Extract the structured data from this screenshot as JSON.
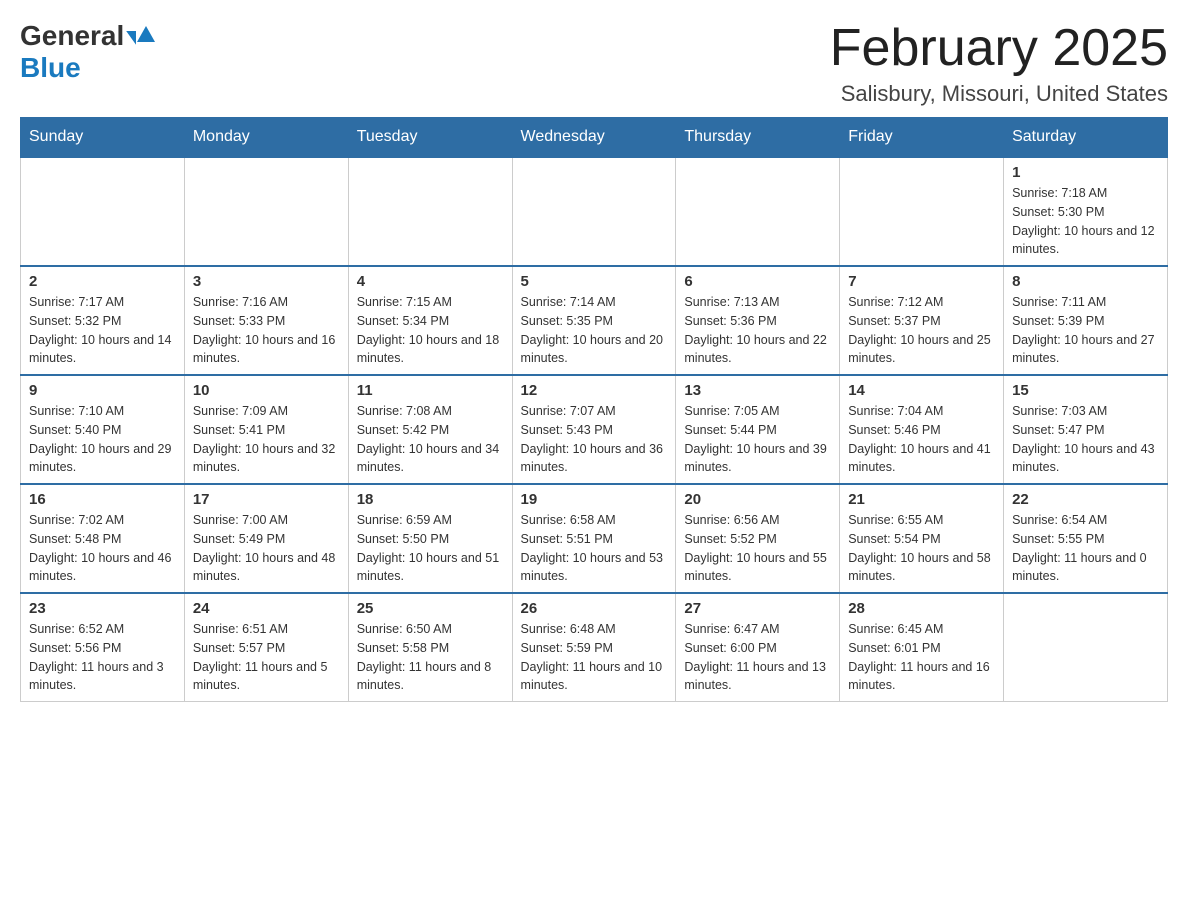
{
  "logo": {
    "general": "General",
    "blue": "Blue",
    "arrow_symbol": "▲"
  },
  "header": {
    "month_year": "February 2025",
    "location": "Salisbury, Missouri, United States"
  },
  "weekdays": [
    "Sunday",
    "Monday",
    "Tuesday",
    "Wednesday",
    "Thursday",
    "Friday",
    "Saturday"
  ],
  "weeks": [
    [
      {
        "day": "",
        "sunrise": "",
        "sunset": "",
        "daylight": ""
      },
      {
        "day": "",
        "sunrise": "",
        "sunset": "",
        "daylight": ""
      },
      {
        "day": "",
        "sunrise": "",
        "sunset": "",
        "daylight": ""
      },
      {
        "day": "",
        "sunrise": "",
        "sunset": "",
        "daylight": ""
      },
      {
        "day": "",
        "sunrise": "",
        "sunset": "",
        "daylight": ""
      },
      {
        "day": "",
        "sunrise": "",
        "sunset": "",
        "daylight": ""
      },
      {
        "day": "1",
        "sunrise": "Sunrise: 7:18 AM",
        "sunset": "Sunset: 5:30 PM",
        "daylight": "Daylight: 10 hours and 12 minutes."
      }
    ],
    [
      {
        "day": "2",
        "sunrise": "Sunrise: 7:17 AM",
        "sunset": "Sunset: 5:32 PM",
        "daylight": "Daylight: 10 hours and 14 minutes."
      },
      {
        "day": "3",
        "sunrise": "Sunrise: 7:16 AM",
        "sunset": "Sunset: 5:33 PM",
        "daylight": "Daylight: 10 hours and 16 minutes."
      },
      {
        "day": "4",
        "sunrise": "Sunrise: 7:15 AM",
        "sunset": "Sunset: 5:34 PM",
        "daylight": "Daylight: 10 hours and 18 minutes."
      },
      {
        "day": "5",
        "sunrise": "Sunrise: 7:14 AM",
        "sunset": "Sunset: 5:35 PM",
        "daylight": "Daylight: 10 hours and 20 minutes."
      },
      {
        "day": "6",
        "sunrise": "Sunrise: 7:13 AM",
        "sunset": "Sunset: 5:36 PM",
        "daylight": "Daylight: 10 hours and 22 minutes."
      },
      {
        "day": "7",
        "sunrise": "Sunrise: 7:12 AM",
        "sunset": "Sunset: 5:37 PM",
        "daylight": "Daylight: 10 hours and 25 minutes."
      },
      {
        "day": "8",
        "sunrise": "Sunrise: 7:11 AM",
        "sunset": "Sunset: 5:39 PM",
        "daylight": "Daylight: 10 hours and 27 minutes."
      }
    ],
    [
      {
        "day": "9",
        "sunrise": "Sunrise: 7:10 AM",
        "sunset": "Sunset: 5:40 PM",
        "daylight": "Daylight: 10 hours and 29 minutes."
      },
      {
        "day": "10",
        "sunrise": "Sunrise: 7:09 AM",
        "sunset": "Sunset: 5:41 PM",
        "daylight": "Daylight: 10 hours and 32 minutes."
      },
      {
        "day": "11",
        "sunrise": "Sunrise: 7:08 AM",
        "sunset": "Sunset: 5:42 PM",
        "daylight": "Daylight: 10 hours and 34 minutes."
      },
      {
        "day": "12",
        "sunrise": "Sunrise: 7:07 AM",
        "sunset": "Sunset: 5:43 PM",
        "daylight": "Daylight: 10 hours and 36 minutes."
      },
      {
        "day": "13",
        "sunrise": "Sunrise: 7:05 AM",
        "sunset": "Sunset: 5:44 PM",
        "daylight": "Daylight: 10 hours and 39 minutes."
      },
      {
        "day": "14",
        "sunrise": "Sunrise: 7:04 AM",
        "sunset": "Sunset: 5:46 PM",
        "daylight": "Daylight: 10 hours and 41 minutes."
      },
      {
        "day": "15",
        "sunrise": "Sunrise: 7:03 AM",
        "sunset": "Sunset: 5:47 PM",
        "daylight": "Daylight: 10 hours and 43 minutes."
      }
    ],
    [
      {
        "day": "16",
        "sunrise": "Sunrise: 7:02 AM",
        "sunset": "Sunset: 5:48 PM",
        "daylight": "Daylight: 10 hours and 46 minutes."
      },
      {
        "day": "17",
        "sunrise": "Sunrise: 7:00 AM",
        "sunset": "Sunset: 5:49 PM",
        "daylight": "Daylight: 10 hours and 48 minutes."
      },
      {
        "day": "18",
        "sunrise": "Sunrise: 6:59 AM",
        "sunset": "Sunset: 5:50 PM",
        "daylight": "Daylight: 10 hours and 51 minutes."
      },
      {
        "day": "19",
        "sunrise": "Sunrise: 6:58 AM",
        "sunset": "Sunset: 5:51 PM",
        "daylight": "Daylight: 10 hours and 53 minutes."
      },
      {
        "day": "20",
        "sunrise": "Sunrise: 6:56 AM",
        "sunset": "Sunset: 5:52 PM",
        "daylight": "Daylight: 10 hours and 55 minutes."
      },
      {
        "day": "21",
        "sunrise": "Sunrise: 6:55 AM",
        "sunset": "Sunset: 5:54 PM",
        "daylight": "Daylight: 10 hours and 58 minutes."
      },
      {
        "day": "22",
        "sunrise": "Sunrise: 6:54 AM",
        "sunset": "Sunset: 5:55 PM",
        "daylight": "Daylight: 11 hours and 0 minutes."
      }
    ],
    [
      {
        "day": "23",
        "sunrise": "Sunrise: 6:52 AM",
        "sunset": "Sunset: 5:56 PM",
        "daylight": "Daylight: 11 hours and 3 minutes."
      },
      {
        "day": "24",
        "sunrise": "Sunrise: 6:51 AM",
        "sunset": "Sunset: 5:57 PM",
        "daylight": "Daylight: 11 hours and 5 minutes."
      },
      {
        "day": "25",
        "sunrise": "Sunrise: 6:50 AM",
        "sunset": "Sunset: 5:58 PM",
        "daylight": "Daylight: 11 hours and 8 minutes."
      },
      {
        "day": "26",
        "sunrise": "Sunrise: 6:48 AM",
        "sunset": "Sunset: 5:59 PM",
        "daylight": "Daylight: 11 hours and 10 minutes."
      },
      {
        "day": "27",
        "sunrise": "Sunrise: 6:47 AM",
        "sunset": "Sunset: 6:00 PM",
        "daylight": "Daylight: 11 hours and 13 minutes."
      },
      {
        "day": "28",
        "sunrise": "Sunrise: 6:45 AM",
        "sunset": "Sunset: 6:01 PM",
        "daylight": "Daylight: 11 hours and 16 minutes."
      },
      {
        "day": "",
        "sunrise": "",
        "sunset": "",
        "daylight": ""
      }
    ]
  ]
}
